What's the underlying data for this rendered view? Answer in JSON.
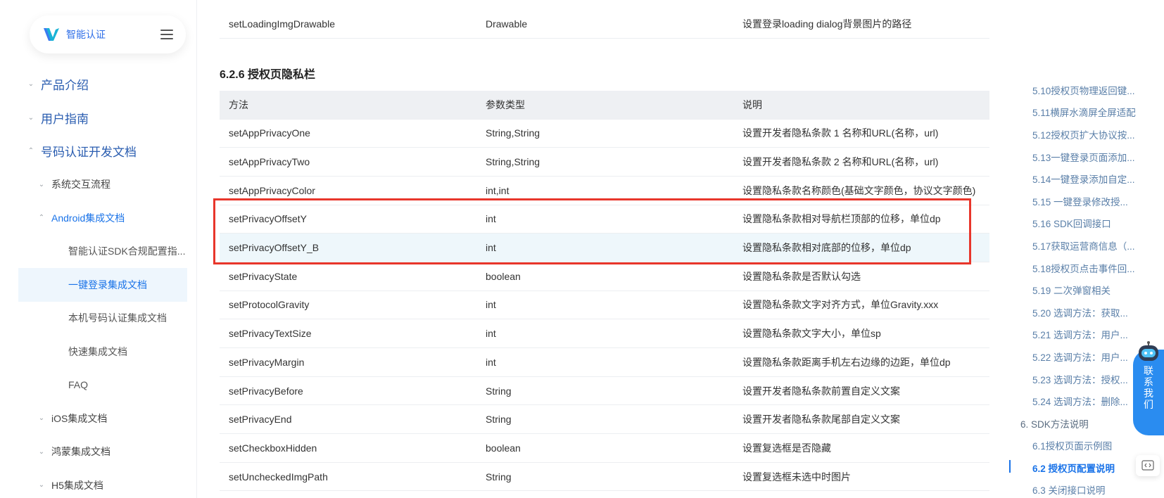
{
  "brand": {
    "name": "智能认证"
  },
  "sidebar": {
    "items": [
      {
        "label": "产品介绍",
        "chev": "⌄"
      },
      {
        "label": "用户指南",
        "chev": "⌄"
      },
      {
        "label": "号码认证开发文档",
        "chev": "⌃"
      },
      {
        "label": "系统交互流程",
        "chev": "⌄"
      },
      {
        "label": "Android集成文档",
        "chev": "⌃"
      },
      {
        "label": "智能认证SDK合规配置指..."
      },
      {
        "label": "一键登录集成文档"
      },
      {
        "label": "本机号码认证集成文档"
      },
      {
        "label": "快速集成文档"
      },
      {
        "label": "FAQ"
      },
      {
        "label": "iOS集成文档",
        "chev": "⌄"
      },
      {
        "label": "鸿蒙集成文档",
        "chev": "⌄"
      },
      {
        "label": "H5集成文档",
        "chev": "⌄"
      }
    ]
  },
  "top_row": {
    "method": "setLoadingImgDrawable",
    "type": "Drawable",
    "desc": "设置登录loading dialog背景图片的路径"
  },
  "section": {
    "title": "6.2.6 授权页隐私栏"
  },
  "table": {
    "headers": [
      "方法",
      "参数类型",
      "说明"
    ],
    "rows": [
      {
        "method": "setAppPrivacyOne",
        "type": "String,String",
        "desc": "设置开发者隐私条款 1 名称和URL(名称，url)"
      },
      {
        "method": "setAppPrivacyTwo",
        "type": "String,String",
        "desc": "设置开发者隐私条款 2 名称和URL(名称，url)"
      },
      {
        "method": "setAppPrivacyColor",
        "type": "int,int",
        "desc": "设置隐私条款名称颜色(基础文字颜色，协议文字颜色)"
      },
      {
        "method": "setPrivacyOffsetY",
        "type": "int",
        "desc": "设置隐私条款相对导航栏顶部的位移，单位dp"
      },
      {
        "method": "setPrivacyOffsetY_B",
        "type": "int",
        "desc": "设置隐私条款相对底部的位移，单位dp"
      },
      {
        "method": "setPrivacyState",
        "type": "boolean",
        "desc": "设置隐私条款是否默认勾选"
      },
      {
        "method": "setProtocolGravity",
        "type": "int",
        "desc": "设置隐私条款文字对齐方式，单位Gravity.xxx"
      },
      {
        "method": "setPrivacyTextSize",
        "type": "int",
        "desc": "设置隐私条款文字大小，单位sp"
      },
      {
        "method": "setPrivacyMargin",
        "type": "int",
        "desc": "设置隐私条款距离手机左右边缘的边距，单位dp"
      },
      {
        "method": "setPrivacyBefore",
        "type": "String",
        "desc": "设置开发者隐私条款前置自定义文案"
      },
      {
        "method": "setPrivacyEnd",
        "type": "String",
        "desc": "设置开发者隐私条款尾部自定义文案"
      },
      {
        "method": "setCheckboxHidden",
        "type": "boolean",
        "desc": "设置复选框是否隐藏"
      },
      {
        "method": "setUncheckedImgPath",
        "type": "String",
        "desc": "设置复选框未选中时图片"
      }
    ]
  },
  "toc": {
    "items": [
      "5.10授权页物理返回键...",
      "5.11横屏水滴屏全屏适配",
      "5.12授权页扩大协议按...",
      "5.13一键登录页面添加...",
      "5.14一键登录添加自定...",
      "5.15 一键登录修改授...",
      "5.16 SDK回调接口",
      "5.17获取运营商信息（...",
      "5.18授权页点击事件回...",
      "5.19 二次弹窗相关",
      "5.20 选调方法：获取...",
      "5.21 选调方法：用户...",
      "5.22 选调方法：用户...",
      "5.23 选调方法：授权...",
      "5.24 选调方法：删除...",
      "6. SDK方法说明",
      "6.1授权页面示例图",
      "6.2 授权页配置说明",
      "6.3 关闭接口说明"
    ]
  },
  "contact": {
    "label": "联系我们"
  },
  "colors": {
    "accent": "#1a73e8",
    "highlight_box": "#e8362b",
    "contact_bg": "#2a8cf0"
  }
}
